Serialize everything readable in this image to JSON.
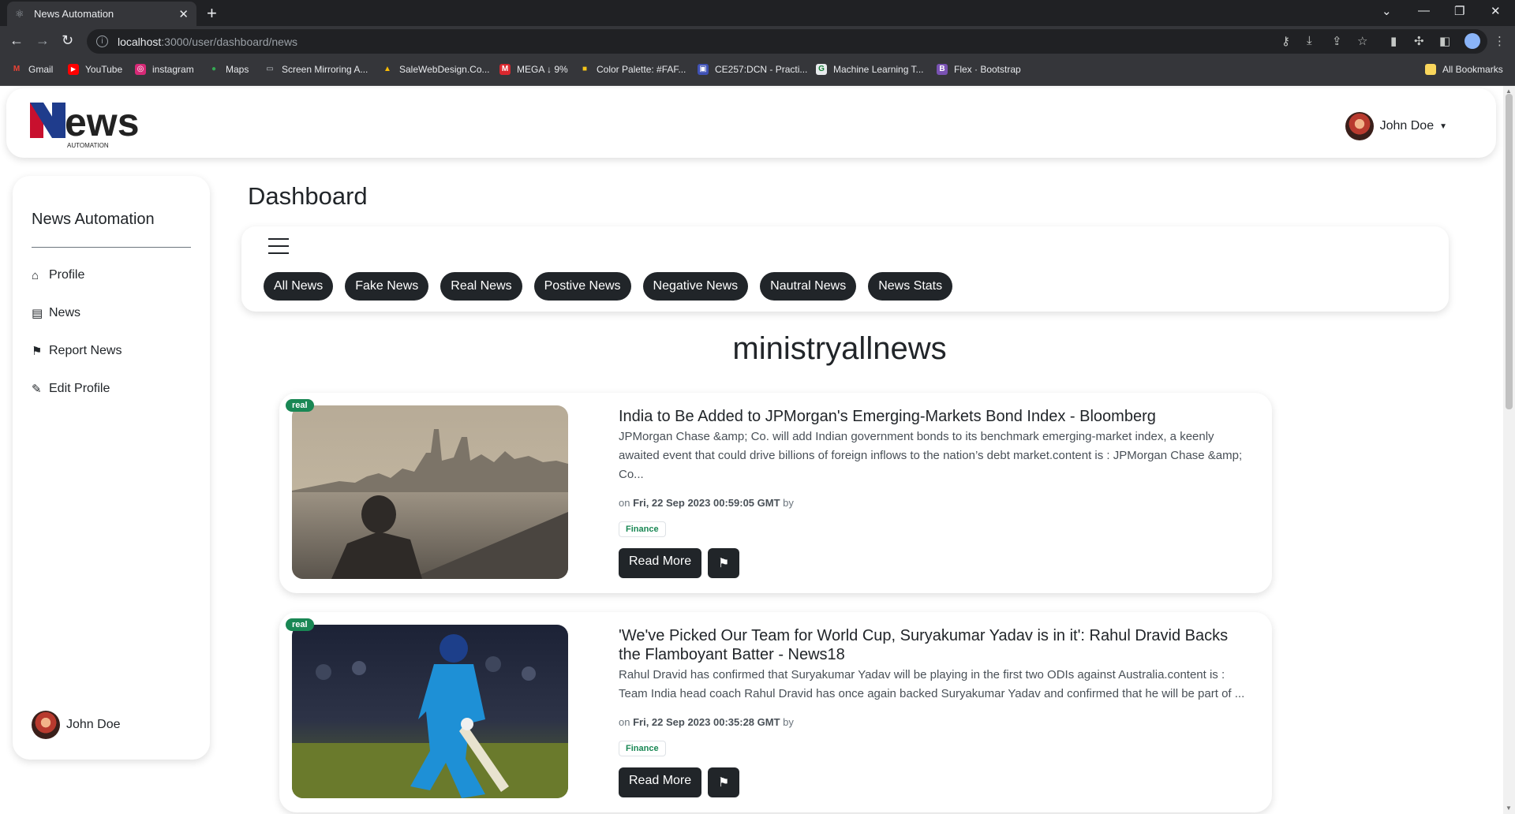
{
  "browser": {
    "tab_title": "News Automation",
    "url_host": "localhost",
    "url_path": ":3000/user/dashboard/news",
    "bookmarks": [
      {
        "label": "Gmail",
        "icon": "gmail-icon",
        "color": "#ea4335",
        "glyph": "M"
      },
      {
        "label": "YouTube",
        "icon": "youtube-icon",
        "color": "#ff0000",
        "glyph": "▶"
      },
      {
        "label": "instagram",
        "icon": "instagram-icon",
        "color": "#d62976",
        "glyph": "◎"
      },
      {
        "label": "Maps",
        "icon": "maps-icon",
        "color": "#34a853",
        "glyph": "●"
      },
      {
        "label": "Screen Mirroring A...",
        "icon": "screen-mirroring-icon",
        "color": "#5f6368",
        "glyph": "▭"
      },
      {
        "label": "SaleWebDesign.Co...",
        "icon": "drive-icon",
        "color": "#fbbc04",
        "glyph": "▲"
      },
      {
        "label": "MEGA ↓ 9%",
        "icon": "mega-icon",
        "color": "#d9272e",
        "glyph": "M"
      },
      {
        "label": "Color Palette: #FAF...",
        "icon": "color-palette-icon",
        "color": "#f5c518",
        "glyph": "■"
      },
      {
        "label": "CE257:DCN - Practi...",
        "icon": "ce257-icon",
        "color": "#3f51b5",
        "glyph": "▣"
      },
      {
        "label": "Machine Learning T...",
        "icon": "machine-learning-icon",
        "color": "#e8eaed",
        "glyph": "G"
      },
      {
        "label": "Flex · Bootstrap",
        "icon": "bootstrap-icon",
        "color": "#7952b3",
        "glyph": "B"
      }
    ],
    "all_bookmarks": "All Bookmarks"
  },
  "header": {
    "logo_word": "ews",
    "logo_sub": "AUTOMATION",
    "user_name": "John Doe"
  },
  "sidebar": {
    "title": "News Automation",
    "items": [
      {
        "label": "Profile",
        "icon": "home-icon"
      },
      {
        "label": "News",
        "icon": "newspaper-icon"
      },
      {
        "label": "Report News",
        "icon": "flag-icon"
      },
      {
        "label": "Edit Profile",
        "icon": "edit-icon"
      }
    ],
    "user_name": "John Doe"
  },
  "main": {
    "page_title": "Dashboard",
    "filters": [
      "All News",
      "Fake News",
      "Real News",
      "Postive News",
      "Negative News",
      "Nautral News",
      "News Stats"
    ],
    "section_title": "ministryallnews",
    "read_more_label": "Read More",
    "articles": [
      {
        "badge": "real",
        "title": "India to Be Added to JPMorgan's Emerging-Markets Bond Index - Bloomberg",
        "description": "JPMorgan Chase &amp; Co. will add Indian government bonds to its benchmark emerging-market index, a keenly awaited event that could drive billions of foreign inflows to the nation’s debt market.content is : JPMorgan Chase &amp; Co...",
        "meta_prefix": "on",
        "date": "Fri, 22 Sep 2023 00:59:05 GMT",
        "meta_suffix": "by",
        "category": "Finance"
      },
      {
        "badge": "real",
        "title": "'We've Picked Our Team for World Cup, Suryakumar Yadav is in it': Rahul Dravid Backs the Flamboyant Batter - News18",
        "description": "Rahul Dravid has confirmed that Suryakumar Yadav will be playing in the first two ODIs against Australia.content is : Team India head coach Rahul Dravid has once again backed Suryakumar Yadav and confirmed that he will be part of ...",
        "meta_prefix": "on",
        "date": "Fri, 22 Sep 2023 00:35:28 GMT",
        "meta_suffix": "by",
        "category": "Finance"
      }
    ]
  }
}
